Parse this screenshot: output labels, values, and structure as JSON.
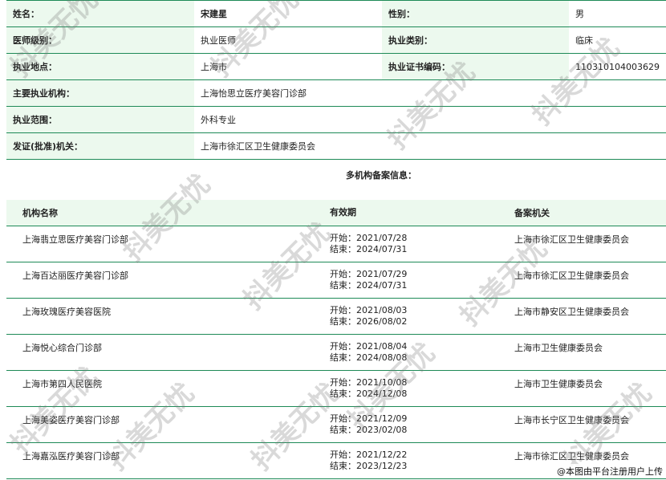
{
  "info": {
    "rows": [
      {
        "l1": "姓名：",
        "v1": "宋建星",
        "l2": "性别：",
        "v2": "男"
      },
      {
        "l1": "医师级别：",
        "v1": "执业医师",
        "l2": "执业类别：",
        "v2": "临床"
      },
      {
        "l1": "执业地点：",
        "v1": "上海市",
        "l2": "执业证书编码：",
        "v2": "110310104003629"
      }
    ],
    "wide_rows": [
      {
        "l": "主要执业机构：",
        "v": "上海怡思立医疗美容门诊部"
      },
      {
        "l": "执业范围：",
        "v": "外科专业"
      },
      {
        "l": "发证(批准)机关：",
        "v": "上海市徐汇区卫生健康委员会"
      }
    ]
  },
  "multi_title": "多机构备案信息：",
  "records": {
    "headers": {
      "name": "机构名称",
      "validity": "有效期",
      "authority": "备案机关"
    },
    "rows": [
      {
        "name": "上海翡立思医疗美容门诊部",
        "start": "开始：2021/07/28",
        "end": "结束：2024/07/31",
        "authority": "上海市徐汇区卫生健康委员会"
      },
      {
        "name": "上海百达丽医疗美容门诊部",
        "start": "开始：2021/07/29",
        "end": "结束：2024/07/31",
        "authority": "上海市徐汇区卫生健康委员会"
      },
      {
        "name": "上海玫瑰医疗美容医院",
        "start": "开始：2021/08/03",
        "end": "结束：2026/08/02",
        "authority": "上海市静安区卫生健康委员会"
      },
      {
        "name": "上海悦心综合门诊部",
        "start": "开始：2021/08/04",
        "end": "结束：2024/08/08",
        "authority": "上海市卫生健康委员会"
      },
      {
        "name": "上海市第四人民医院",
        "start": "开始：2021/10/08",
        "end": "结束：2024/12/08",
        "authority": "上海市卫生健康委员会"
      },
      {
        "name": "上海美姿医疗美容门诊部",
        "start": "开始：2021/12/09",
        "end": "结束：2023/02/08",
        "authority": "上海市长宁区卫生健康委员会"
      },
      {
        "name": "上海嘉泓医疗美容门诊部",
        "start": "开始：2021/12/22",
        "end": "结束：2023/12/23",
        "authority": "上海市徐汇区卫生健康委员会"
      }
    ]
  },
  "watermark": "抖美无忧",
  "footer_note": "@本图由平台注册用户上传",
  "colors": {
    "label_bg": "#ecf9ee",
    "border": "#1e8a57"
  }
}
